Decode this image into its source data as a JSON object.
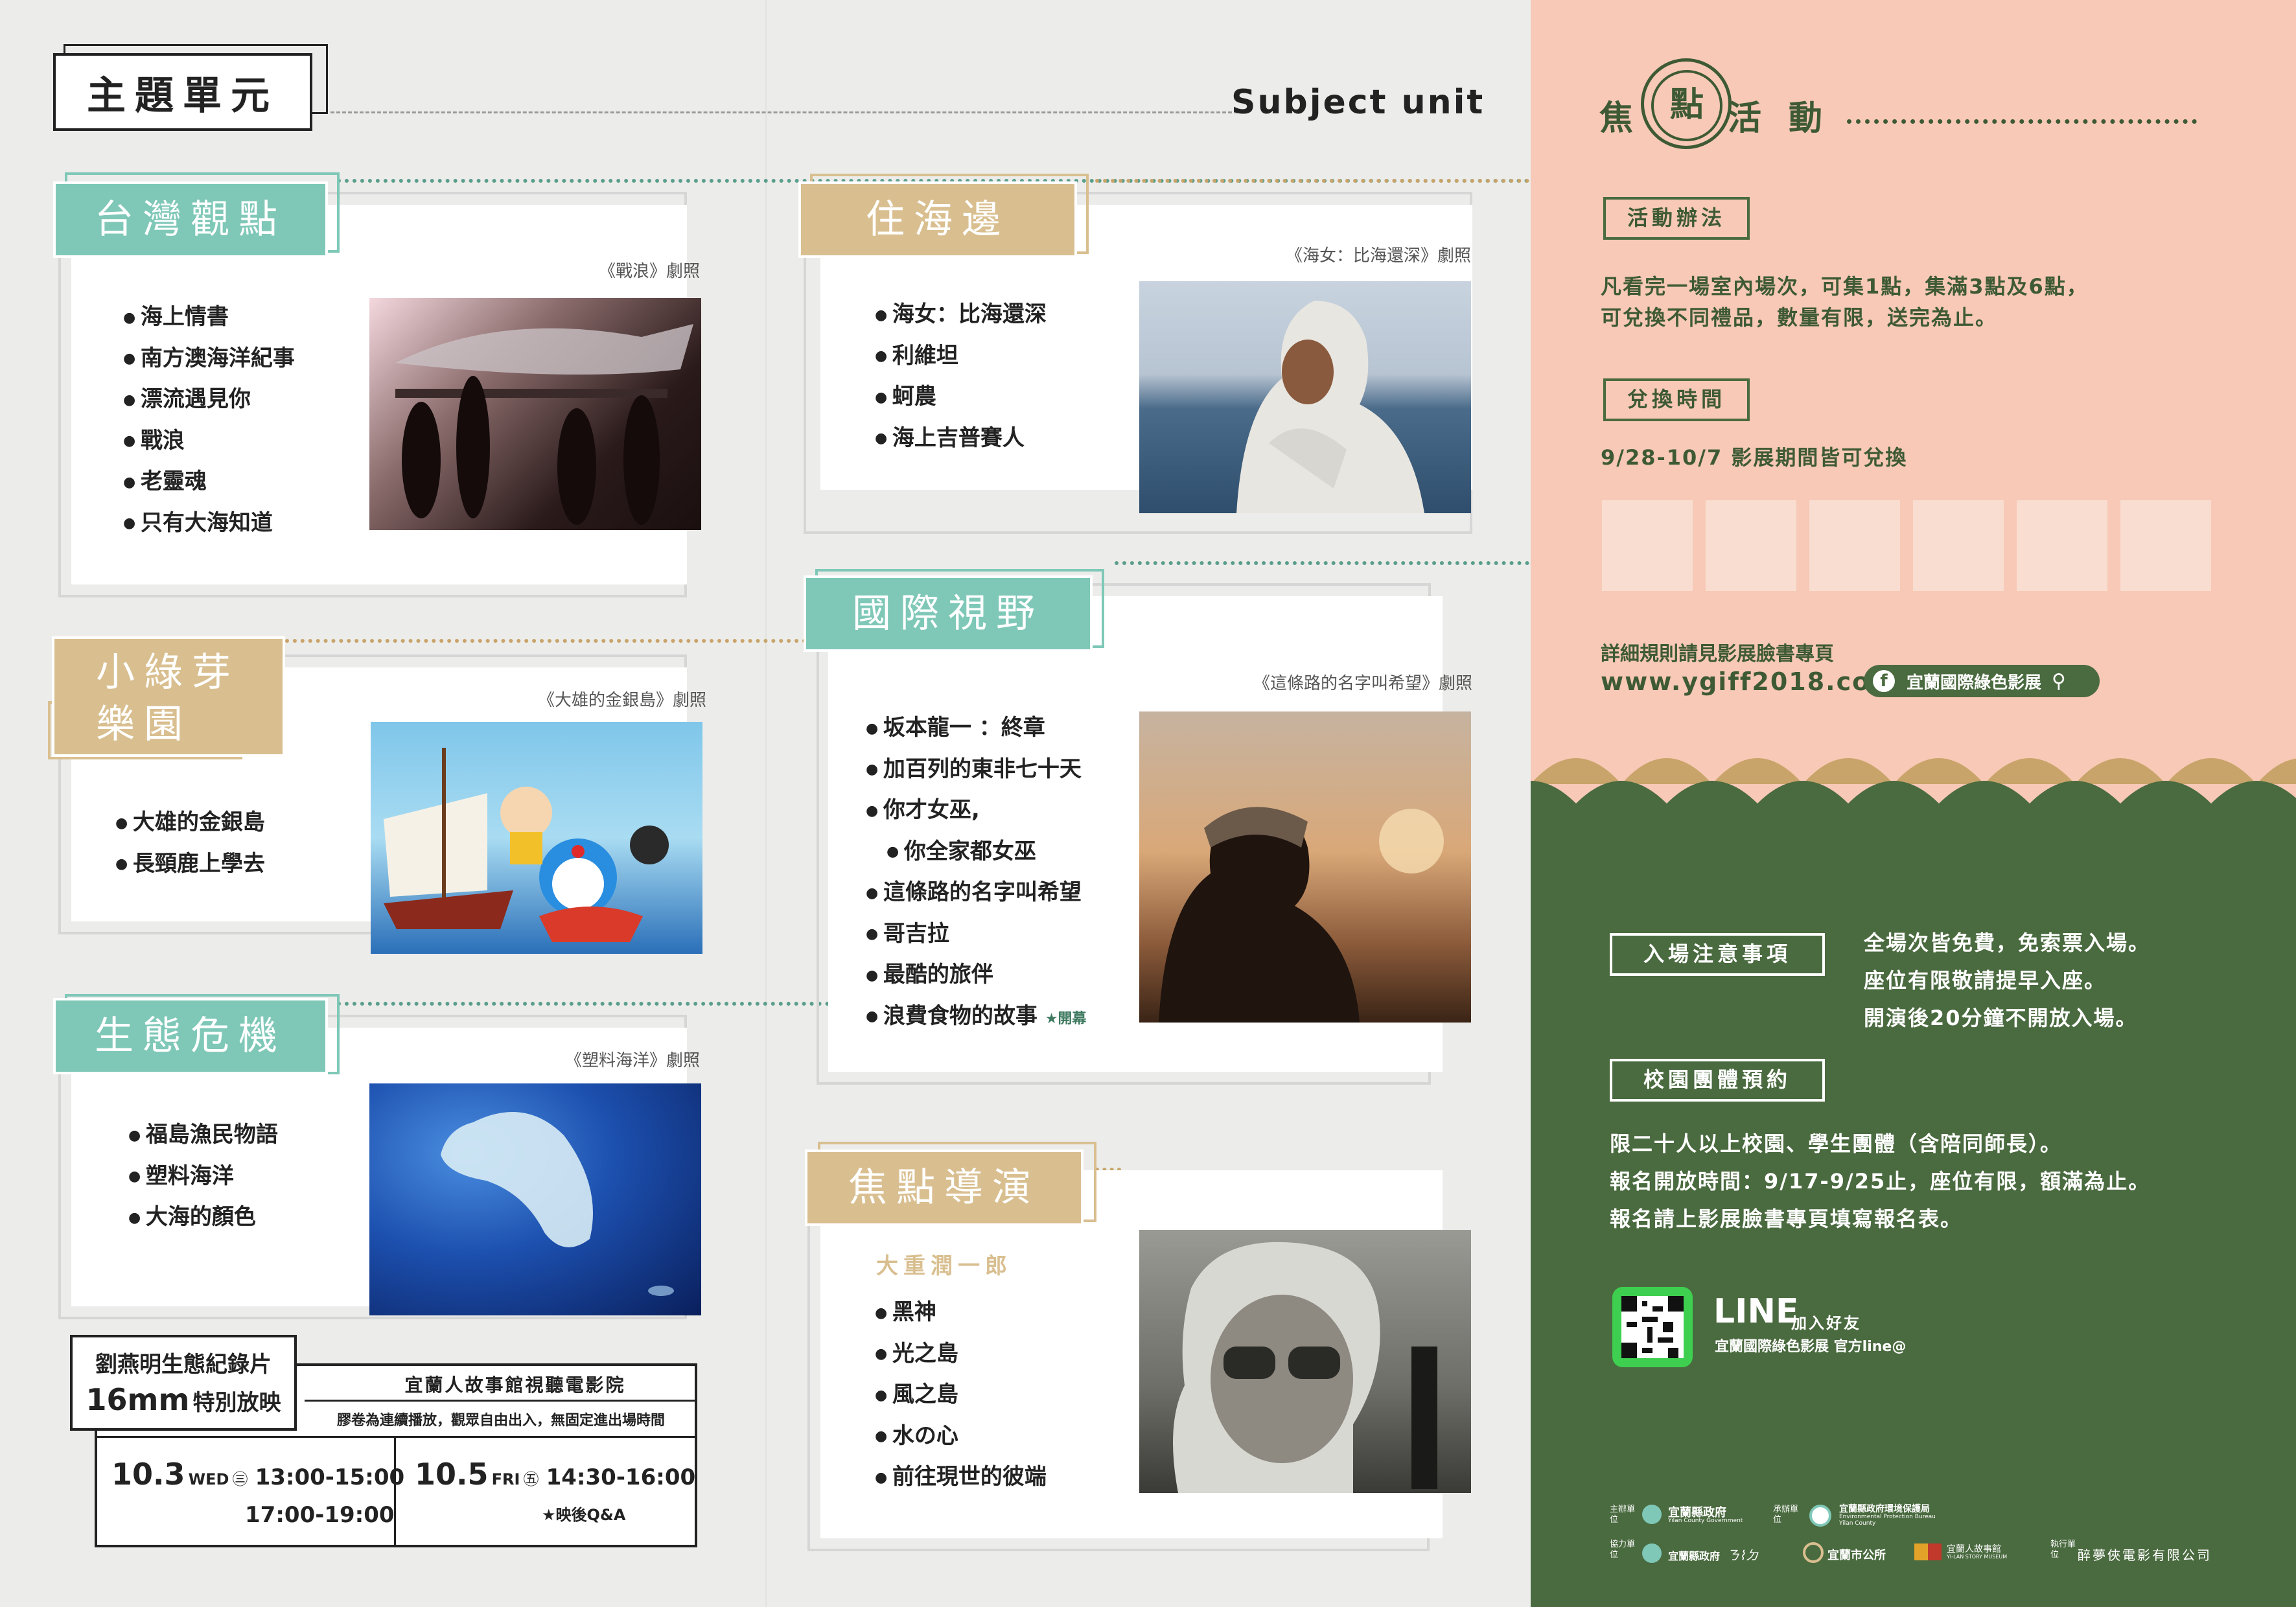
{
  "header": {
    "title": "主題單元",
    "subtitle": "Subject unit"
  },
  "units": {
    "taiwan": {
      "tab": "台灣觀點",
      "caption": "《戰浪》劇照",
      "films": [
        "海上情書",
        "南方澳海洋紀事",
        "漂流遇見你",
        "戰浪",
        "老靈魂",
        "只有大海知道"
      ]
    },
    "kids": {
      "tab_line1": "小綠芽",
      "tab_line2": "樂園",
      "caption": "《大雄的金銀島》劇照",
      "films": [
        "大雄的金銀島",
        "長頸鹿上學去"
      ]
    },
    "eco": {
      "tab": "生態危機",
      "caption": "《塑料海洋》劇照",
      "films": [
        "福島漁民物語",
        "塑料海洋",
        "大海的顏色"
      ]
    },
    "sea": {
      "tab": "住海邊",
      "caption": "《海女：比海還深》劇照",
      "films": [
        "海女：比海還深",
        "利維坦",
        "蚵農",
        "海上吉普賽人"
      ]
    },
    "intl": {
      "tab": "國際視野",
      "caption": "《這條路的名字叫希望》劇照",
      "films": [
        "坂本龍一 ：終章",
        "加百列的東非七十天",
        "你才女巫,",
        "你全家都女巫",
        "這條路的名字叫希望",
        "哥吉拉",
        "最酷的旅伴",
        "浪費食物的故事"
      ],
      "opening_note": "★開幕"
    },
    "director": {
      "tab": "焦點導演",
      "name": "大重潤一郎",
      "films": [
        "黑神",
        "光之島",
        "風之島",
        "水の心",
        "前往現世的彼端"
      ]
    }
  },
  "special": {
    "title_line1": "劉燕明生態紀錄片",
    "title_num": "16mm",
    "title_rest": "特別放映",
    "venue": "宜蘭人故事館視聽電影院",
    "note": "膠卷為連續播放，觀眾自由出入，無固定進出場時間",
    "day1_date": "10.3",
    "day1_dow": "WED",
    "day1_num": "㊂",
    "day1_t1": "13:00-15:00",
    "day1_t2": "17:00-19:00",
    "day2_date": "10.5",
    "day2_dow": "FRI",
    "day2_num": "㊄",
    "day2_t1": "14:30-16:00",
    "day2_note": "★映後Q&A"
  },
  "focus": {
    "title_a": "焦",
    "title_b": "點",
    "title_c": "活",
    "title_d": "動",
    "how_label": "活動辦法",
    "how_line1": "凡看完一場室內場次，可集1點，集滿3點及6點，",
    "how_line2": "可兌換不同禮品，數量有限，送完為止。",
    "redeem_label": "兌換時間",
    "redeem_text": "9/28-10/7 影展期間皆可兌換",
    "rules_text": "詳細規則請見影展臉書專頁",
    "url": "www.ygiff2018.com",
    "fb_label": "宜蘭國際綠色影展"
  },
  "entry": {
    "label": "入場注意事項",
    "lines": [
      "全場次皆免費，免索票入場。",
      "座位有限敬請提早入座。",
      "開演後20分鐘不開放入場。"
    ]
  },
  "school": {
    "label": "校園團體預約",
    "lines": [
      "限二十人以上校園、學生團體（含陪同師長）。",
      "報名開放時間：9/17-9/25止，座位有限，額滿為止。",
      "報名請上影展臉書專頁填寫報名表。"
    ]
  },
  "line": {
    "title": "LINE",
    "add": "加入好友",
    "account": "宜蘭國際綠色影展 官方line@"
  },
  "credits": {
    "host_label": "主辦單位",
    "host": "宜蘭縣政府",
    "host_en": "Yilan County Government",
    "org_label": "承辦單位",
    "org": "宜蘭縣政府環境保護局",
    "org_en": "Environmental Protection Bureau Yilan County",
    "co_label": "協力單位",
    "co1": "宜蘭縣政府",
    "co2": "宜蘭市公所",
    "co3": "宜蘭人故事館",
    "co3_en": "YI-LAN STORY MUSEUM",
    "exec_label": "執行單位",
    "exec": "醉夢俠電影有限公司"
  },
  "colors": {
    "teal": "#7fc8b8",
    "gold": "#d9bf90",
    "pink": "#f7c9b6",
    "green": "#4a6a3f"
  }
}
